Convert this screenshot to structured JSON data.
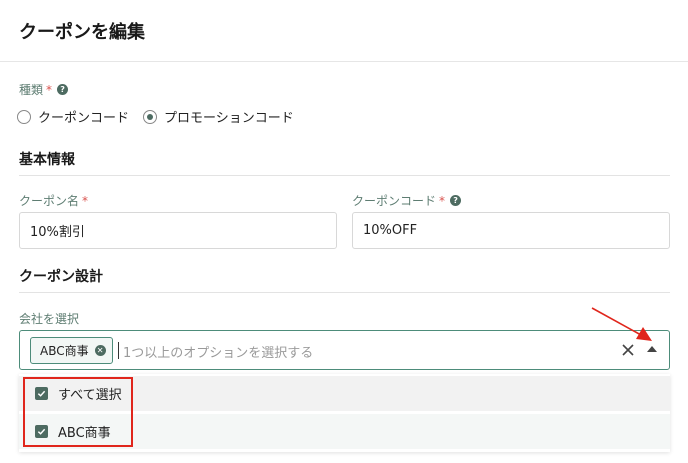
{
  "page": {
    "title": "クーポンを編集"
  },
  "type_field": {
    "label": "種類",
    "required_mark": "*",
    "help": "?",
    "options": [
      {
        "label": "クーポンコード",
        "selected": false
      },
      {
        "label": "プロモーションコード",
        "selected": true
      }
    ]
  },
  "basic_info": {
    "title": "基本情報",
    "coupon_name": {
      "label": "クーポン名",
      "required_mark": "*",
      "value": "10%割引"
    },
    "coupon_code": {
      "label": "クーポンコード",
      "required_mark": "*",
      "help": "?",
      "value": "10%OFF"
    }
  },
  "design": {
    "title": "クーポン設計",
    "company_select": {
      "label": "会社を選択",
      "chips": [
        {
          "label": "ABC商事"
        }
      ],
      "placeholder": "1つ以上のオプションを選択する",
      "options": [
        {
          "label": "すべて選択",
          "checked": true
        },
        {
          "label": "ABC商事",
          "checked": true
        }
      ]
    }
  },
  "colors": {
    "accent": "#4d6b61",
    "focus_border": "#4d8c7a",
    "label": "#5e7d72",
    "required": "#d9534f",
    "annotation": "#e0261c"
  },
  "icons": [
    "help-icon",
    "chip-remove-icon",
    "clear-icon",
    "chevron-up-icon",
    "check-icon",
    "annotation-arrow"
  ]
}
